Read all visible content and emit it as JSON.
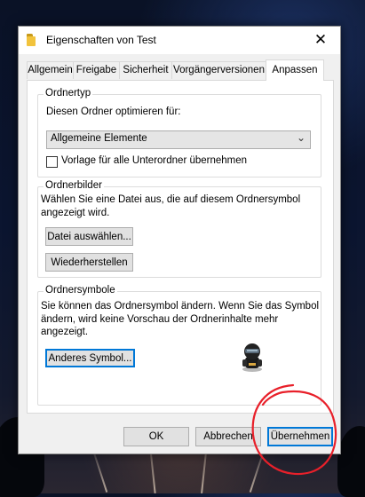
{
  "window": {
    "title": "Eigenschaften von Test",
    "close_glyph": "✕",
    "folder_icon": "folder-icon"
  },
  "tabs": [
    {
      "label": "Allgemein",
      "active": false
    },
    {
      "label": "Freigabe",
      "active": false
    },
    {
      "label": "Sicherheit",
      "active": false
    },
    {
      "label": "Vorgängerversionen",
      "active": false
    },
    {
      "label": "Anpassen",
      "active": true
    }
  ],
  "ordnertyp": {
    "title": "Ordnertyp",
    "optimize_label": "Diesen Ordner optimieren für:",
    "selected": "Allgemeine Elemente",
    "checkbox_label": "Vorlage für alle Unterordner übernehmen",
    "checkbox_checked": false
  },
  "ordnerbilder": {
    "title": "Ordnerbilder",
    "description_line1": "Wählen Sie eine Datei aus, die auf diesem Ordnersymbol",
    "description_line2": "angezeigt wird.",
    "choose_file": "Datei auswählen...",
    "restore": "Wiederherstellen"
  },
  "ordnersymbole": {
    "title": "Ordnersymbole",
    "description_line1": "Sie können das Ordnersymbol ändern. Wenn Sie das Symbol",
    "description_line2": "ändern, wird keine Vorschau der Ordnerinhalte mehr angezeigt.",
    "change_symbol": "Anderes Symbol...",
    "preview_icon": "ninja-character-icon"
  },
  "footer": {
    "ok": "OK",
    "cancel": "Abbrechen",
    "apply": "Übernehmen"
  },
  "colors": {
    "accent": "#0078d7",
    "annotation": "#e8202a"
  }
}
